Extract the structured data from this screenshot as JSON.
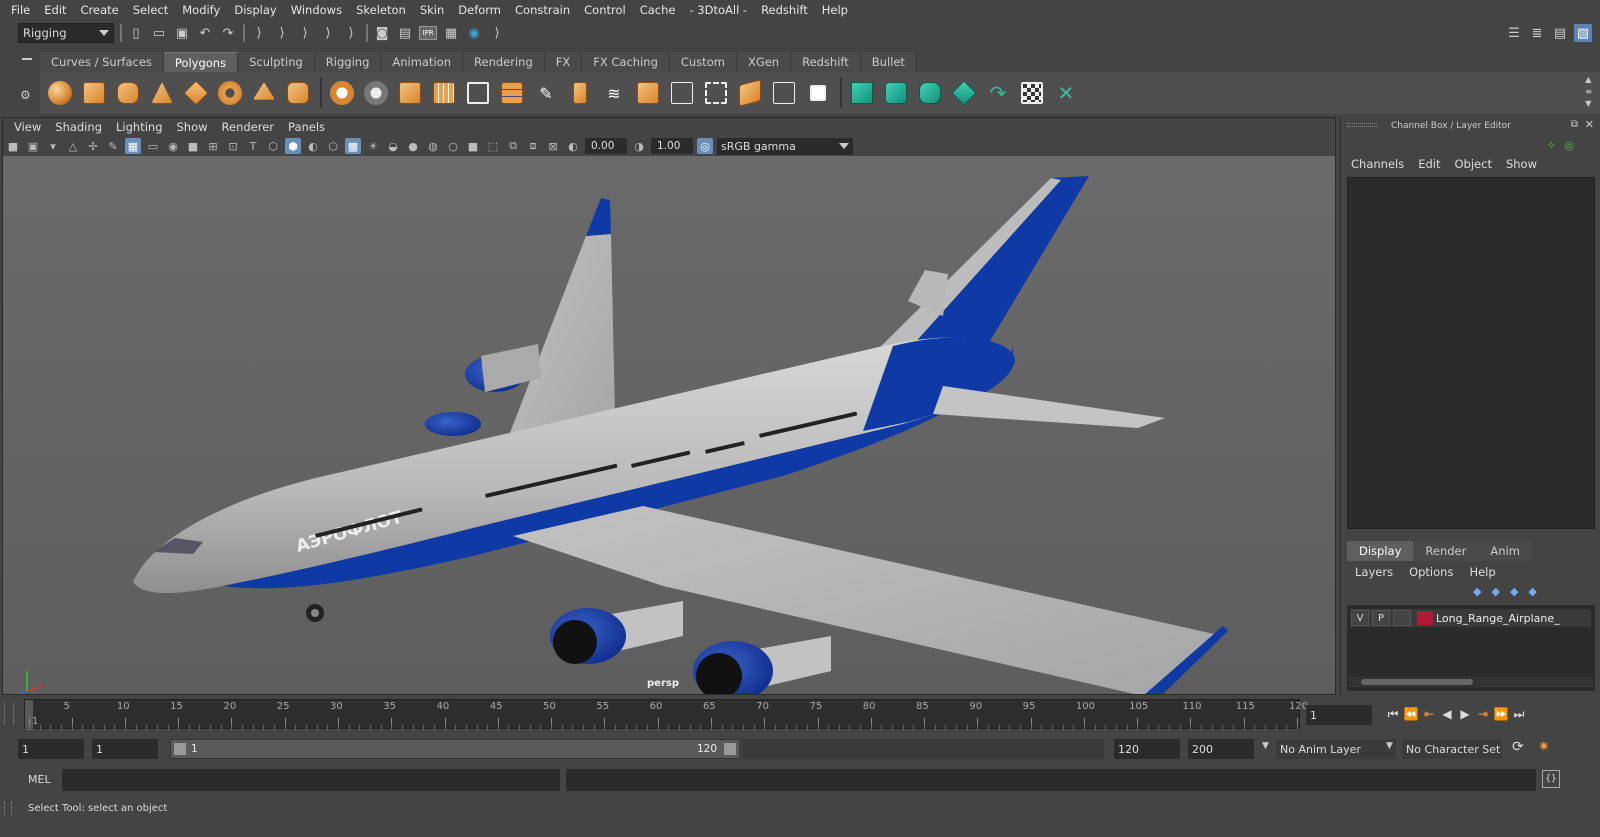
{
  "menubar": [
    "File",
    "Edit",
    "Create",
    "Select",
    "Modify",
    "Display",
    "Windows",
    "Skeleton",
    "Skin",
    "Deform",
    "Constrain",
    "Control",
    "Cache",
    "- 3DtoAll -",
    "Redshift",
    "Help"
  ],
  "mode_select": "Rigging",
  "shelf_tabs": [
    "Curves / Surfaces",
    "Polygons",
    "Sculpting",
    "Rigging",
    "Animation",
    "Rendering",
    "FX",
    "FX Caching",
    "Custom",
    "XGen",
    "Redshift",
    "Bullet"
  ],
  "active_shelf_tab": "Polygons",
  "panel_menu": [
    "View",
    "Shading",
    "Lighting",
    "Show",
    "Renderer",
    "Panels"
  ],
  "panel_toolbar": {
    "exposure": "0.00",
    "gamma": "1.00",
    "color_space": "sRGB gamma"
  },
  "viewport": {
    "camera_label": "persp",
    "livery_text": "АЭРОФЛОТ"
  },
  "channel_box": {
    "title": "Channel Box / Layer Editor",
    "menu": [
      "Channels",
      "Edit",
      "Object",
      "Show"
    ],
    "layer_tabs": [
      "Display",
      "Render",
      "Anim"
    ],
    "layer_menu": [
      "Layers",
      "Options",
      "Help"
    ],
    "layer": {
      "v": "V",
      "p": "P",
      "name": "Long_Range_Airplane_",
      "color": "#b2183a"
    }
  },
  "timeline": {
    "ticks": [
      "1",
      "5",
      "10",
      "15",
      "20",
      "25",
      "30",
      "35",
      "40",
      "45",
      "50",
      "55",
      "60",
      "65",
      "70",
      "75",
      "80",
      "85",
      "90",
      "95",
      "100",
      "105",
      "110",
      "115",
      "120"
    ],
    "current_frame": "1"
  },
  "range": {
    "start": "1",
    "playback_start": "1",
    "slider_start": "1",
    "slider_end": "120",
    "playback_end": "120",
    "end": "200",
    "anim_layer": "No Anim Layer",
    "character_set": "No Character Set"
  },
  "cmdline": {
    "label": "MEL"
  },
  "helpline": {
    "text": "Select Tool: select an object"
  }
}
